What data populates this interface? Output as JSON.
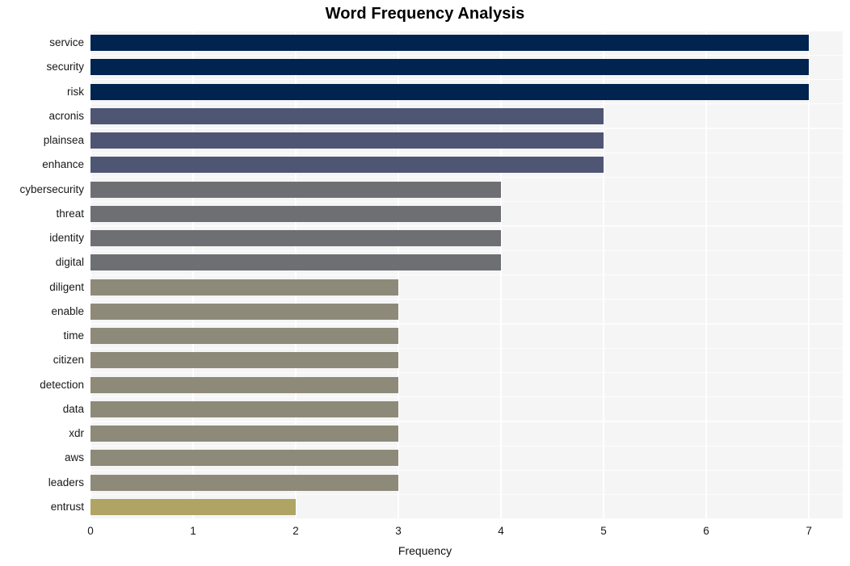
{
  "chart_data": {
    "type": "bar",
    "orientation": "horizontal",
    "title": "Word Frequency Analysis",
    "xlabel": "Frequency",
    "ylabel": "",
    "xlim": [
      0,
      7.33
    ],
    "xticks": [
      "0",
      "1",
      "2",
      "3",
      "4",
      "5",
      "6",
      "7"
    ],
    "xtick_values": [
      0,
      1,
      2,
      3,
      4,
      5,
      6,
      7
    ],
    "grid": true,
    "legend": "none",
    "categories": [
      "service",
      "security",
      "risk",
      "acronis",
      "plainsea",
      "enhance",
      "cybersecurity",
      "threat",
      "identity",
      "digital",
      "diligent",
      "enable",
      "time",
      "citizen",
      "detection",
      "data",
      "xdr",
      "aws",
      "leaders",
      "entrust"
    ],
    "values": [
      7,
      7,
      7,
      5,
      5,
      5,
      4,
      4,
      4,
      4,
      3,
      3,
      3,
      3,
      3,
      3,
      3,
      3,
      3,
      2
    ],
    "bar_colors": [
      "#00234f",
      "#00234f",
      "#00234f",
      "#4f5674",
      "#4f5674",
      "#4f5674",
      "#6d6f73",
      "#6d6f73",
      "#6d6f73",
      "#6d6f73",
      "#8e8a79",
      "#8e8a79",
      "#8e8a79",
      "#8e8a79",
      "#8e8a79",
      "#8e8a79",
      "#8e8a79",
      "#8e8a79",
      "#8e8a79",
      "#b0a465"
    ],
    "plot_background": "#f5f5f6",
    "grid_color": "#ffffff",
    "figure_background": "#ffffff"
  }
}
